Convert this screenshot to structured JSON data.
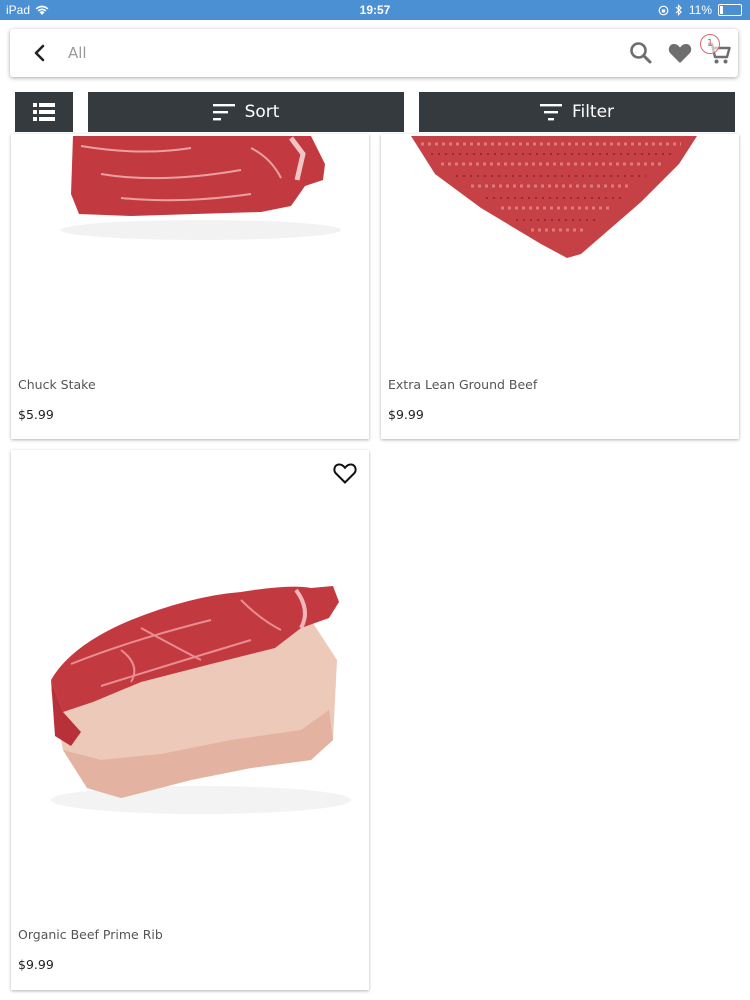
{
  "status_bar": {
    "device": "iPad",
    "time": "19:57",
    "battery": "11%"
  },
  "header": {
    "search_placeholder": "All",
    "cart_count": "1"
  },
  "toolbar": {
    "sort_label": "Sort",
    "filter_label": "Filter"
  },
  "products": [
    {
      "name": "Chuck Stake",
      "price": "$5.99"
    },
    {
      "name": "Extra Lean Ground Beef",
      "price": "$9.99"
    },
    {
      "name": "Organic Beef Prime Rib",
      "price": "$9.99"
    }
  ],
  "colors": {
    "status_bar": "#4a90d2",
    "toolbar": "#353a3e",
    "badge": "#d86a6a"
  }
}
